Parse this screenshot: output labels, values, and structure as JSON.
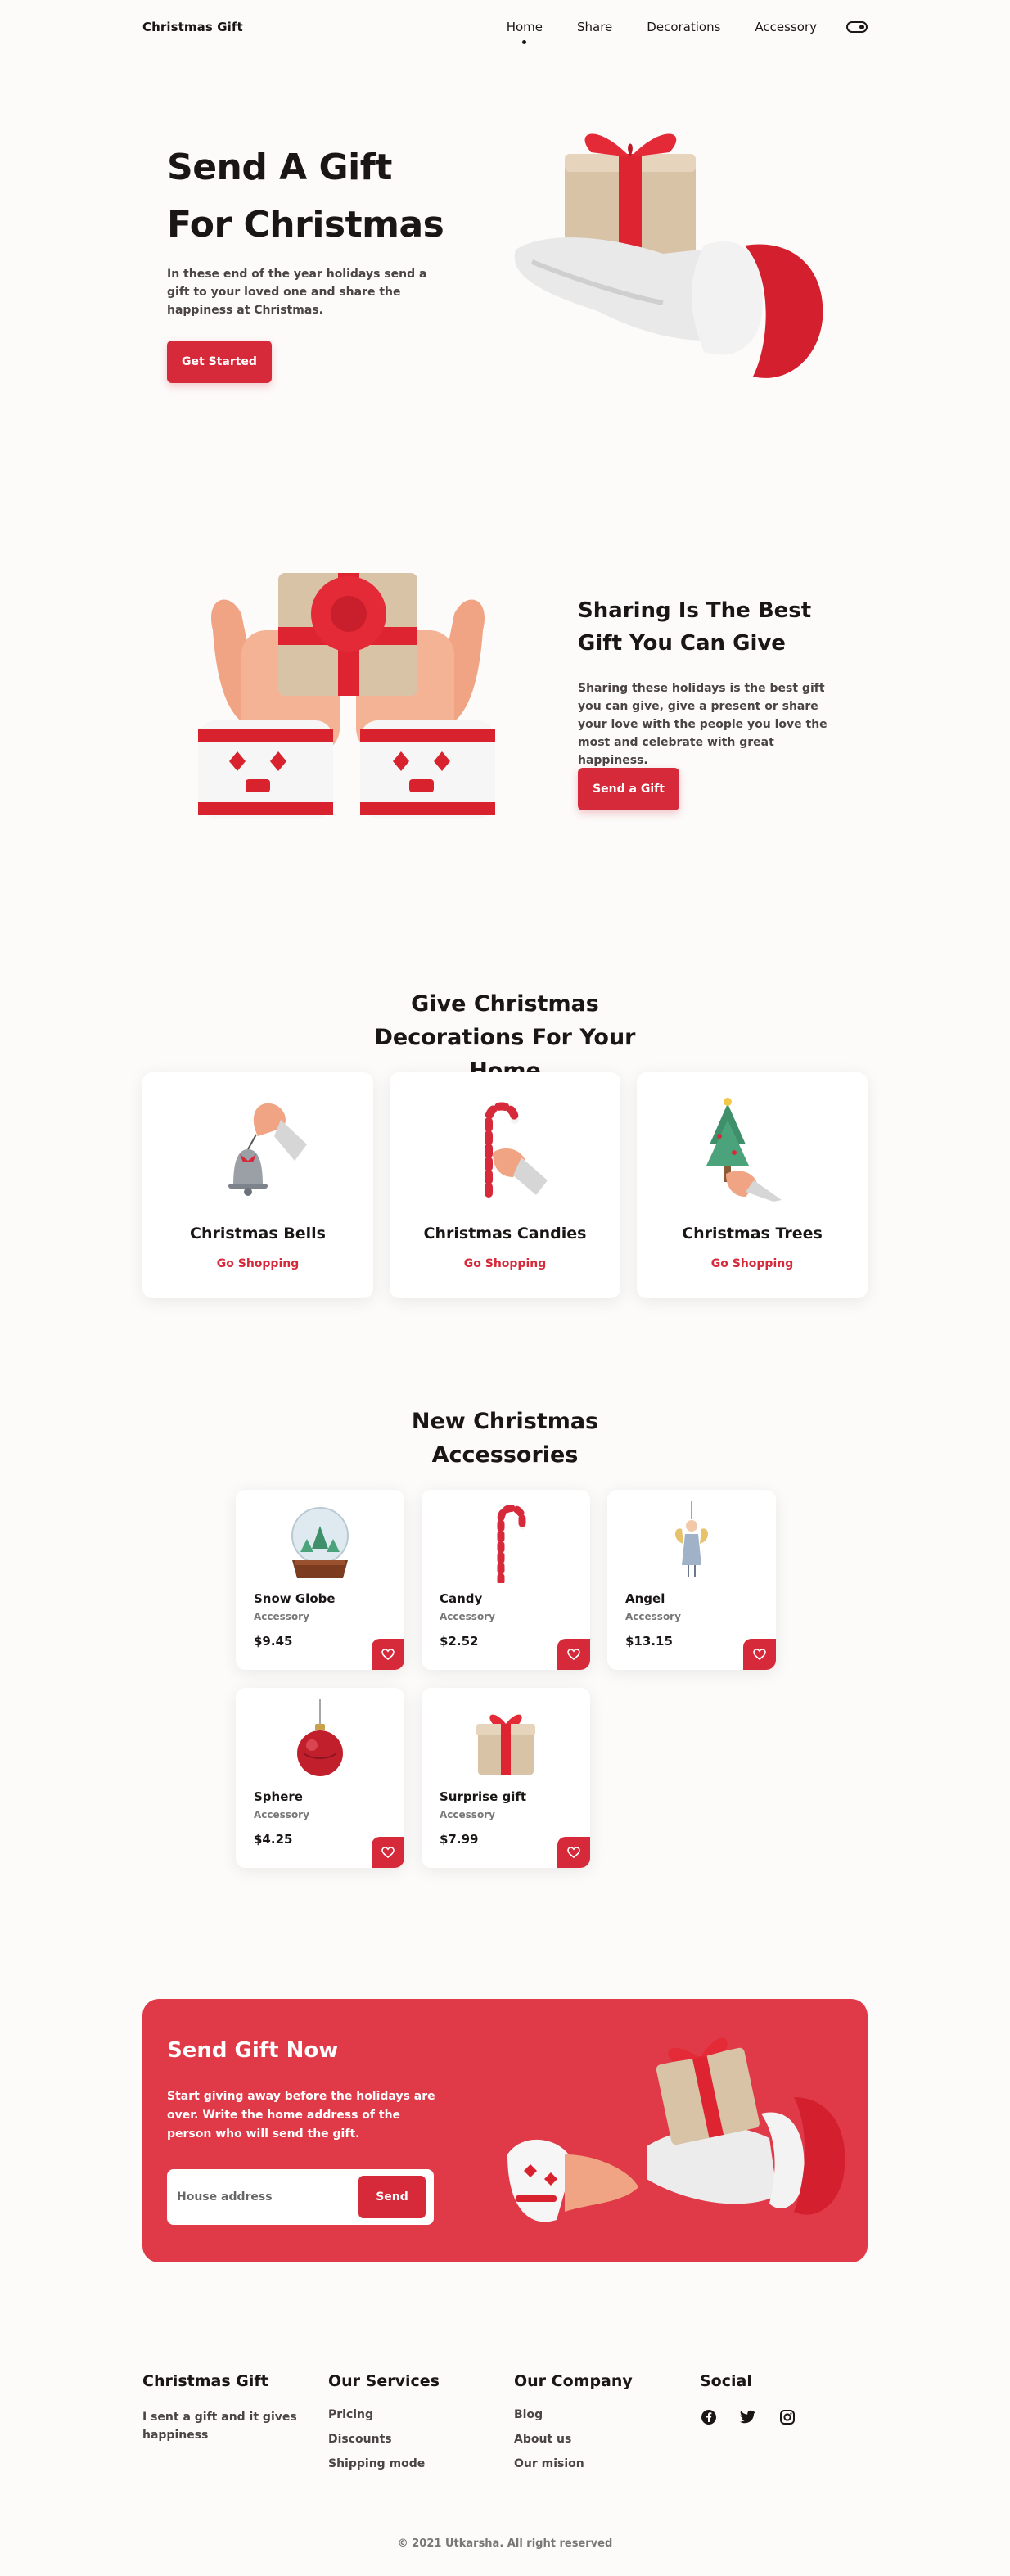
{
  "header": {
    "logo": "Christmas Gift",
    "nav": [
      {
        "label": "Home",
        "active": true
      },
      {
        "label": "Share",
        "active": false
      },
      {
        "label": "Decorations",
        "active": false
      },
      {
        "label": "Accessory",
        "active": false
      }
    ],
    "theme_toggle_icon": "toggle-icon"
  },
  "hero": {
    "title": "Send A Gift For Christmas",
    "description": "In these end of the year holidays send a gift to your loved one and share the happiness at Christmas.",
    "button": "Get Started",
    "image_icon": "gloved-hand-gift"
  },
  "share": {
    "title": "Sharing Is The Best Gift You Can Give",
    "description": "Sharing these holidays is the best gift you can give, give a present or share your love with the people you love the most and celebrate with great happiness.",
    "button": "Send a Gift",
    "image_icon": "hands-holding-gift"
  },
  "decorations": {
    "title": "Give Christmas Decorations For Your Home",
    "cards": [
      {
        "name": "Christmas Bells",
        "link": "Go Shopping",
        "icon": "bell-icon"
      },
      {
        "name": "Christmas Candies",
        "link": "Go Shopping",
        "icon": "candy-cane-icon"
      },
      {
        "name": "Christmas Trees",
        "link": "Go Shopping",
        "icon": "tree-icon"
      }
    ]
  },
  "accessories": {
    "title": "New Christmas Accessories",
    "items": [
      {
        "name": "Snow Globe",
        "type": "Accessory",
        "price": "$9.45",
        "icon": "snow-globe-icon"
      },
      {
        "name": "Candy",
        "type": "Accessory",
        "price": "$2.52",
        "icon": "candy-cane-icon"
      },
      {
        "name": "Angel",
        "type": "Accessory",
        "price": "$13.15",
        "icon": "angel-icon"
      },
      {
        "name": "Sphere",
        "type": "Accessory",
        "price": "$4.25",
        "icon": "ornament-icon"
      },
      {
        "name": "Surprise gift",
        "type": "Accessory",
        "price": "$7.99",
        "icon": "gift-box-icon"
      }
    ],
    "favorite_icon": "heart-icon"
  },
  "banner": {
    "title": "Send Gift Now",
    "description": "Start giving away before the holidays are over. Write the home address of the person who will send the gift.",
    "input_placeholder": "House address",
    "button": "Send",
    "image_icon": "hands-exchanging-gift"
  },
  "footer": {
    "brand": {
      "title": "Christmas Gift",
      "text": "I sent a gift and it gives happiness"
    },
    "services": {
      "title": "Our Services",
      "links": [
        "Pricing",
        "Discounts",
        "Shipping mode"
      ]
    },
    "company": {
      "title": "Our Company",
      "links": [
        "Blog",
        "About us",
        "Our mision"
      ]
    },
    "social": {
      "title": "Social",
      "icons": [
        "facebook-icon",
        "twitter-icon",
        "instagram-icon"
      ]
    },
    "copyright": "© 2021 Utkarsha. All right reserved"
  },
  "colors": {
    "accent": "#d62a3b",
    "banner": "#e03a49",
    "background": "#fcfbfa",
    "text": "#1a1616"
  }
}
